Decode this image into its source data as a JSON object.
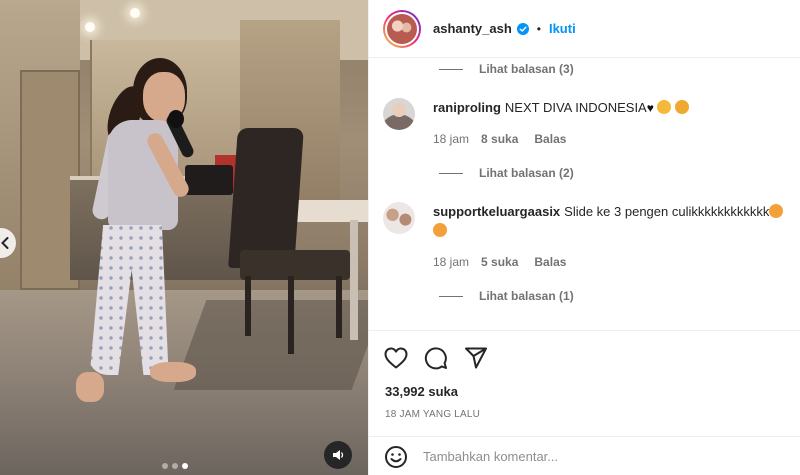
{
  "post": {
    "author": "ashanty_ash",
    "follow_label": "Ikuti",
    "separator": "•"
  },
  "comments": [
    {
      "user": "raniproling",
      "text": "NEXT DIVA INDONESIA",
      "time": "18 jam",
      "likes": "8 suka",
      "reply_label": "Balas",
      "replies_label": "Lihat balasan (2)"
    },
    {
      "user": "supportkeluargaasix",
      "text": "Slide ke 3 pengen culikkkkkkkkkkkk",
      "time": "18 jam",
      "likes": "5 suka",
      "reply_label": "Balas",
      "replies_label": "Lihat balasan (1)"
    }
  ],
  "earlier_replies_label": "Lihat balasan (3)",
  "actions": {
    "like_count": "33,992 suka",
    "time_ago": "18 JAM YANG LALU",
    "comment_placeholder": "Tambahkan komentar..."
  },
  "media": {
    "slide_count": 3,
    "active_slide": 3
  },
  "icons": {
    "verified": "verified-badge-icon",
    "like": "heart-icon",
    "comment": "comment-bubble-icon",
    "share": "paper-plane-icon",
    "emoji": "smiley-icon",
    "audio": "speaker-icon",
    "prev": "chevron-left-icon"
  },
  "colors": {
    "accent": "#0095f6",
    "text": "#262626",
    "muted": "#737373"
  }
}
